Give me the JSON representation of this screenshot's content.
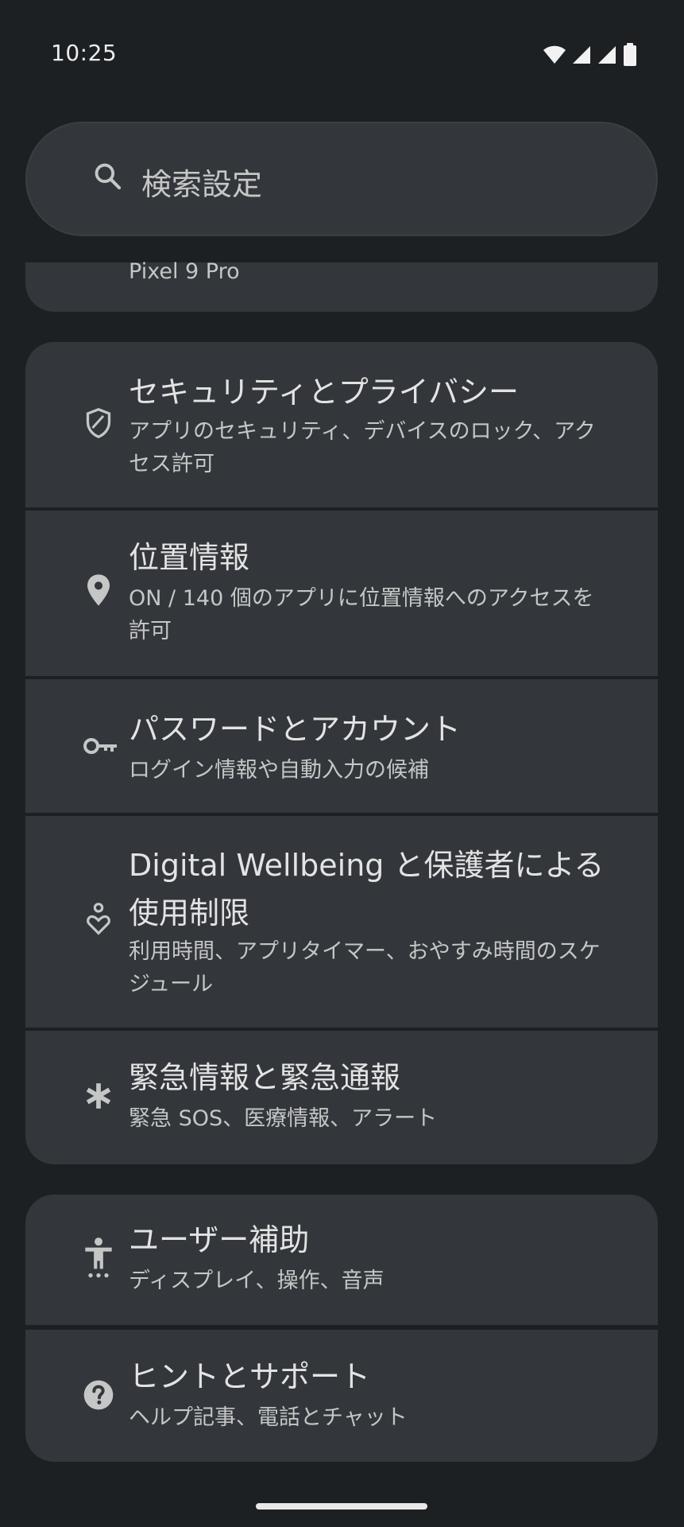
{
  "status_bar": {
    "time": "10:25"
  },
  "search": {
    "placeholder": "検索設定"
  },
  "about_card": {
    "subtitle": "Pixel 9 Pro"
  },
  "settings": [
    {
      "title": "セキュリティとプライバシー",
      "subtitle": "アプリのセキュリティ、デバイスのロック、アクセス許可",
      "icon": "shield-icon"
    },
    {
      "title": "位置情報",
      "subtitle": "ON / 140 個のアプリに位置情報へのアクセスを許可",
      "icon": "location-pin-icon"
    },
    {
      "title": "パスワードとアカウント",
      "subtitle": "ログイン情報や自動入力の候補",
      "icon": "key-icon"
    },
    {
      "title": "Digital Wellbeing と保護者による使用制限",
      "subtitle": "利用時間、アプリタイマー、おやすみ時間のスケジュール",
      "icon": "wellbeing-icon"
    },
    {
      "title": "緊急情報と緊急通報",
      "subtitle": "緊急 SOS、医療情報、アラート",
      "icon": "asterisk-icon"
    },
    {
      "title": "ユーザー補助",
      "subtitle": "ディスプレイ、操作、音声",
      "icon": "accessibility-icon"
    },
    {
      "title": "ヒントとサポート",
      "subtitle": "ヘルプ記事、電話とチャット",
      "icon": "help-icon"
    }
  ]
}
